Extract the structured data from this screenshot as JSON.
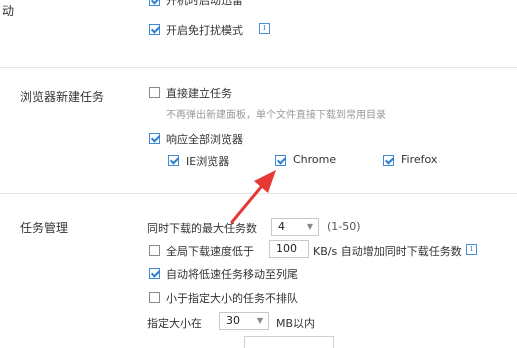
{
  "top": {
    "section_label_partial": "动",
    "cutoff_item": "开机时启动迅雷",
    "do_not_disturb": "开启免打扰模式",
    "info_icon_glyph": "i"
  },
  "browser_task": {
    "section_label": "浏览器新建任务",
    "direct_create": "直接建立任务",
    "direct_create_desc": "不再弹出新建面板，单个文件直接下载到常用目录",
    "respond_all": "响应全部浏览器",
    "browsers": [
      "IE浏览器",
      "Chrome",
      "Firefox"
    ]
  },
  "task_mgmt": {
    "section_label": "任务管理",
    "max_tasks_label": "同时下载的最大任务数",
    "max_tasks_value": "4",
    "max_tasks_range": "(1-50)",
    "speed_low_label": "全局下载速度低于",
    "speed_value": "100",
    "speed_suffix": "KB/s 自动增加同时下载任务数",
    "move_slow_tail": "自动将低速任务移动至列尾",
    "no_queue_small": "小于指定大小的任务不排队",
    "size_label": "指定大小在",
    "size_value": "30",
    "size_unit": "MB以内"
  },
  "colors": {
    "accent": "#2d7fd1",
    "arrow": "#e53935",
    "divider": "#e6e6e6"
  }
}
